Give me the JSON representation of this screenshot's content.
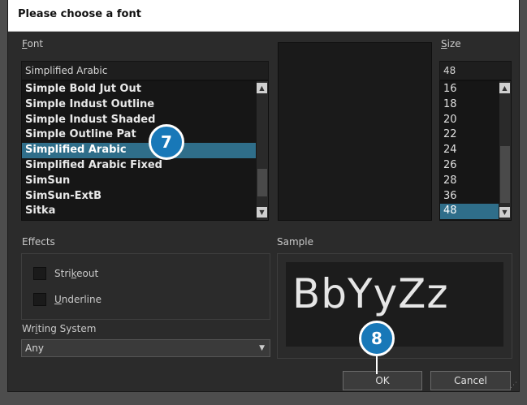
{
  "window": {
    "title": "Please choose a font"
  },
  "font": {
    "label_prefix": "",
    "label_accel": "F",
    "label_rest": "ont",
    "current_value": "Simplified Arabic",
    "items": [
      "Simple Bold Jut Out",
      "Simple Indust Outline",
      "Simple Indust Shaded",
      "Simple Outline Pat",
      "Simplified Arabic",
      "Simplified Arabic Fixed",
      "SimSun",
      "SimSun-ExtB",
      "Sitka"
    ],
    "selected": "Simplified Arabic"
  },
  "size": {
    "label_accel": "S",
    "label_rest": "ize",
    "current_value": "48",
    "items": [
      "16",
      "18",
      "20",
      "22",
      "24",
      "26",
      "28",
      "36",
      "48"
    ],
    "selected": "48"
  },
  "effects": {
    "label": "Effects",
    "strikeout_pre": "Stri",
    "strikeout_accel": "k",
    "strikeout_post": "eout",
    "underline_accel": "U",
    "underline_post": "nderline",
    "strikeout_checked": false,
    "underline_checked": false
  },
  "writing_system": {
    "label_pre": "Wr",
    "label_accel": "i",
    "label_post": "ting System",
    "value": "Any"
  },
  "sample": {
    "label": "Sample",
    "text": "BbYyZz"
  },
  "buttons": {
    "ok": "OK",
    "cancel": "Cancel"
  },
  "callouts": {
    "step7": "7",
    "step8": "8"
  },
  "colors": {
    "selection": "#2f6e8a",
    "callout": "#1878b8"
  }
}
